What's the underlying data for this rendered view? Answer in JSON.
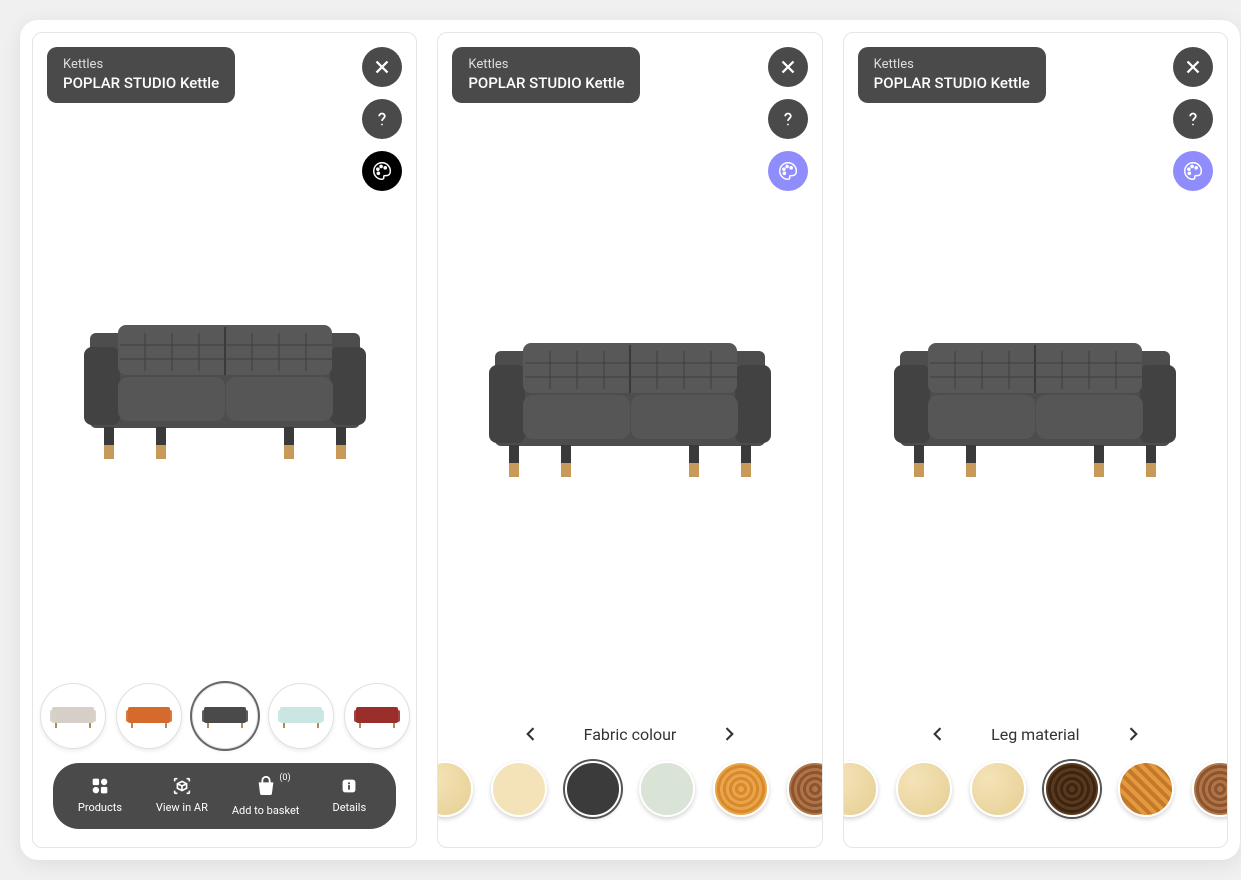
{
  "product": {
    "category": "Kettles",
    "brand": "POPLAR STUDIO",
    "name": "Kettle",
    "title_combined": "POPLAR STUDIO  Kettle"
  },
  "icons": {
    "close": "close-icon",
    "help": "help-icon",
    "palette": "palette-icon"
  },
  "screen1": {
    "palette_active": false,
    "thumbnails": [
      {
        "color": "#d6cfc7",
        "selected": false,
        "partial": "left"
      },
      {
        "color": "#d46a2c",
        "selected": false,
        "partial": ""
      },
      {
        "color": "#4a4a4a",
        "selected": true,
        "partial": ""
      },
      {
        "color": "#c9e6e3",
        "selected": false,
        "partial": ""
      },
      {
        "color": "#9a2e2a",
        "selected": false,
        "partial": "right"
      }
    ],
    "bottom_bar": {
      "products": "Products",
      "view_ar": "View in AR",
      "add_basket": "Add to basket",
      "basket_count": "(0)",
      "details": "Details"
    }
  },
  "screen2": {
    "palette_active": true,
    "variant_label": "Fabric colour",
    "swatches": [
      {
        "type": "wood1",
        "style": "",
        "partial": "left"
      },
      {
        "type": "",
        "style": "background:#f4e3b8",
        "partial": ""
      },
      {
        "type": "",
        "style": "background:#3b3b3b",
        "partial": "",
        "selected": true
      },
      {
        "type": "",
        "style": "background:#d9e3d6",
        "partial": ""
      },
      {
        "type": "wood2",
        "style": "",
        "partial": ""
      },
      {
        "type": "wood5",
        "style": "",
        "partial": "right"
      }
    ]
  },
  "screen3": {
    "palette_active": true,
    "variant_label": "Leg material",
    "swatches": [
      {
        "type": "wood1",
        "style": "",
        "partial": "left"
      },
      {
        "type": "wood1",
        "style": "",
        "partial": ""
      },
      {
        "type": "wood1",
        "style": "",
        "partial": ""
      },
      {
        "type": "wood3",
        "style": "",
        "partial": "",
        "selected": true
      },
      {
        "type": "wood4",
        "style": "",
        "partial": ""
      },
      {
        "type": "wood5",
        "style": "",
        "partial": "right"
      }
    ]
  }
}
